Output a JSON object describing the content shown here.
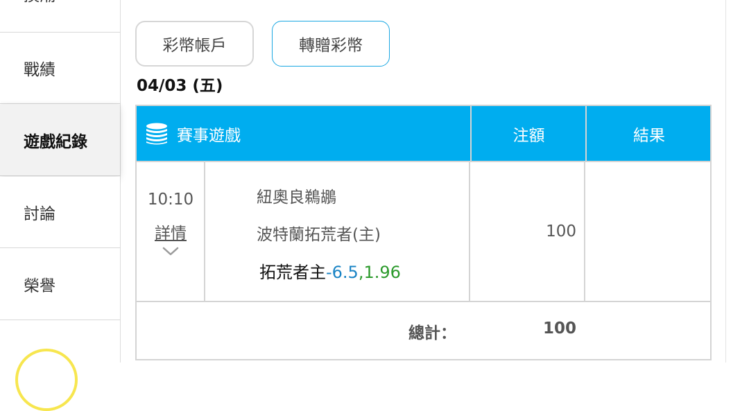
{
  "sidebar": {
    "items": [
      {
        "label": "換潮"
      },
      {
        "label": "戰績"
      },
      {
        "label": "遊戲紀錄"
      },
      {
        "label": "討論"
      },
      {
        "label": "榮譽"
      }
    ],
    "active_index": 2
  },
  "buttons": {
    "account_label": "彩幣帳戶",
    "gift_label": "轉贈彩幣"
  },
  "date": "04/03 (五)",
  "table": {
    "headers": {
      "game": "賽事遊戲",
      "amount": "注額",
      "result": "結果"
    },
    "header_icon": "coin-stack-icon",
    "row": {
      "time": "10:10",
      "detail_label": "詳情",
      "away_team": "紐奧良鵜鶘",
      "home_team": "波特蘭拓荒者(主)",
      "bet_pick": "拓荒者主",
      "bet_line": "-6.5",
      "bet_sep": ",",
      "bet_odds": "1.96",
      "amount": "100",
      "result": ""
    },
    "total_label": "總計：",
    "total_value": "100"
  },
  "colors": {
    "header_bg": "#00adef",
    "gift_border": "#1aa7e2",
    "line_color": "#1a84c5",
    "odds_color": "#2c9a2c",
    "ring": "#f7e64f"
  }
}
